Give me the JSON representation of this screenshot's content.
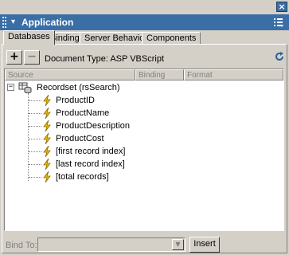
{
  "window": {
    "close_glyph": "×",
    "title": "Application",
    "collapse_glyph": "▾",
    "menu_icon": "options-menu-icon",
    "title_bar_color": "#3a6ea5"
  },
  "tabs": [
    {
      "label": "Databases",
      "active": true
    },
    {
      "label": "Bindings",
      "active": false
    },
    {
      "label": "Server Behaviors",
      "active": false
    },
    {
      "label": "Components",
      "active": false
    }
  ],
  "toolbar": {
    "add_label": "+",
    "remove_label": "−",
    "document_type": "Document Type: ASP VBScript",
    "refresh_icon": "refresh-icon"
  },
  "table": {
    "columns": [
      "Source",
      "Binding",
      "Format"
    ],
    "recordset": {
      "expander": "−",
      "label": "Recordset (rsSearch)",
      "icon": "recordset-icon"
    },
    "fields": [
      "ProductID",
      "ProductName",
      "ProductDescription",
      "ProductCost",
      "[first record index]",
      "[last record index]",
      "[total records]"
    ]
  },
  "footer": {
    "bind_to_label": "Bind To:",
    "bind_to_value": "",
    "insert_label": "Insert"
  }
}
